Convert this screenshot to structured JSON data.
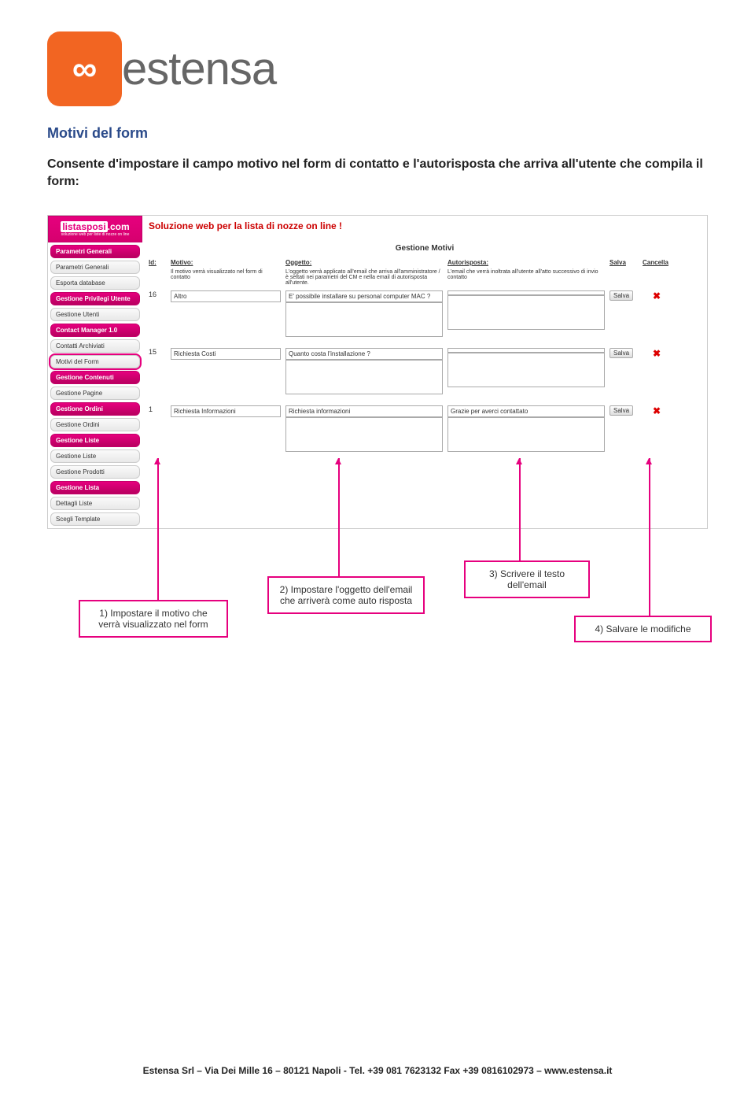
{
  "brand": {
    "logo_symbol": "∞",
    "logo_text": "estensa"
  },
  "heading": "Motivi del form",
  "paragraph": "Consente d'impostare il campo motivo nel form di contatto e l'autorisposta che arriva all'utente che compila il form:",
  "screenshot": {
    "site_logo_top": "listasposi",
    "site_logo_bottom": ".com",
    "site_logo_sub": "soluzione web per liste di nozze on line",
    "main_title": "Soluzione web per la lista di nozze on line !",
    "section_title": "Gestione Motivi",
    "sidebar": {
      "groups": [
        {
          "type": "head",
          "label": "Parametri Generali"
        },
        {
          "type": "item",
          "label": "Parametri Generali"
        },
        {
          "type": "item",
          "label": "Esporta database"
        },
        {
          "type": "head",
          "label": "Gestione Privilegi Utente"
        },
        {
          "type": "item",
          "label": "Gestione Utenti"
        },
        {
          "type": "head",
          "label": "Contact Manager 1.0"
        },
        {
          "type": "item",
          "label": "Contatti Archiviati"
        },
        {
          "type": "item",
          "label": "Motivi del Form",
          "highlight": true
        },
        {
          "type": "head",
          "label": "Gestione Contenuti"
        },
        {
          "type": "item",
          "label": "Gestione Pagine"
        },
        {
          "type": "head",
          "label": "Gestione Ordini"
        },
        {
          "type": "item",
          "label": "Gestione Ordini"
        },
        {
          "type": "head",
          "label": "Gestione Liste"
        },
        {
          "type": "item",
          "label": "Gestione Liste"
        },
        {
          "type": "item",
          "label": "Gestione Prodotti"
        },
        {
          "type": "head",
          "label": "Gestione Lista"
        },
        {
          "type": "item",
          "label": "Dettagli Liste"
        },
        {
          "type": "item",
          "label": "Scegli Template"
        }
      ]
    },
    "columns": {
      "id": "Id:",
      "motivo": "Motivo:",
      "oggetto": "Oggetto:",
      "autorisposta": "Autorisposta:",
      "salva": "Salva",
      "cancella": "Cancella"
    },
    "col_desc": {
      "motivo": "Il motivo verrà visualizzato nel form di contatto",
      "oggetto": "L'oggetto verrà applicato all'email che arriva all'amministratore /è settati nei parametri del CM e nella email di autorisposta all'utente.",
      "autorisposta": "L'email che verrà inoltrata all'utente all'atto successivo di invio contatto"
    },
    "rows": [
      {
        "id": "16",
        "motivo": "Altro",
        "oggetto": "E' possibile installare su personal computer MAC ?",
        "autorisposta": "",
        "salva": "Salva"
      },
      {
        "id": "15",
        "motivo": "Richiesta Costi",
        "oggetto": "Quanto costa l'installazione ?",
        "autorisposta": "",
        "salva": "Salva"
      },
      {
        "id": "1",
        "motivo": "Richiesta Informazioni",
        "oggetto": "Richiesta informazioni",
        "autorisposta": "Grazie per averci contattato",
        "salva": "Salva"
      }
    ]
  },
  "callouts": {
    "c1": "1) Impostare il motivo che verrà visualizzato nel form",
    "c2": "2) Impostare l'oggetto dell'email che arriverà come auto risposta",
    "c3": "3) Scrivere il testo dell'email",
    "c4": "4) Salvare le modifiche"
  },
  "footer": "Estensa Srl – Via Dei Mille 16 – 80121 Napoli  - Tel. +39 081 7623132 Fax +39 0816102973 – www.estensa.it"
}
